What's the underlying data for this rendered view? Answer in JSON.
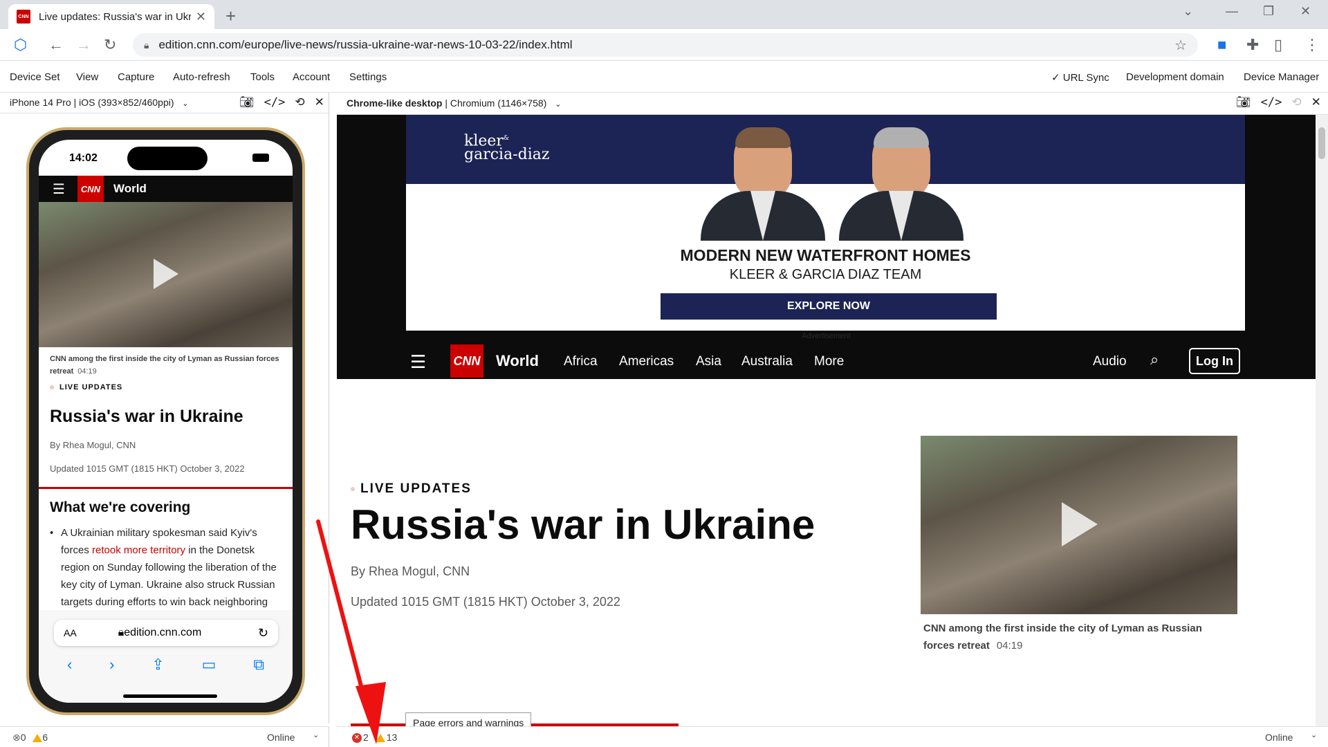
{
  "browser": {
    "tab_title": "Live updates: Russia's war in Ukraine",
    "favicon_text": "CNN",
    "url": "edition.cnn.com/europe/live-news/russia-ukraine-war-news-10-03-22/index.html"
  },
  "menubar": {
    "left": [
      "Device Set",
      "View",
      "Capture",
      "Auto-refresh",
      "Tools",
      "Account",
      "Settings"
    ],
    "url_sync": "✓ URL Sync",
    "dev_domain": "Development domain",
    "device_manager": "Device Manager"
  },
  "left_pane": {
    "device": "iPhone 14 Pro",
    "device_detail": " | iOS (393×852/460ppi)",
    "phone_time": "14:02",
    "nav_logo": "CNN",
    "nav_section": "World",
    "video_caption": "CNN among the first inside the city of Lyman as Russian forces retreat",
    "video_duration": "04:19",
    "live_label": "LIVE UPDATES",
    "title": "Russia's war in Ukraine",
    "byline": "By Rhea Mogul, CNN",
    "updated": "Updated 1015 GMT (1815 HKT) October 3, 2022",
    "covering_heading": "What we're covering",
    "bullet_pre": "A Ukrainian military spokesman said Kyiv's forces ",
    "bullet_link": "retook more territory",
    "bullet_post": " in the Donetsk region on Sunday following the liberation of the key city of Lyman. Ukraine also struck Russian targets during efforts to win back neighboring Luhansk, the spokesman added.",
    "safari_aa": "AA",
    "safari_host": "edition.cnn.com",
    "status_errors": "0",
    "status_warnings": "6",
    "status_online": "Online"
  },
  "right_pane": {
    "device": "Chrome-like desktop",
    "device_detail": " | Chromium (1146×758)",
    "ad": {
      "logo_line1": "kleer",
      "logo_amp": "&",
      "logo_line2": "garcia-diaz",
      "headline": "MODERN NEW WATERFRONT HOMES",
      "subline": "KLEER & GARCIA DIAZ TEAM",
      "cta": "EXPLORE NOW",
      "label": "Advertisement"
    },
    "nav": {
      "logo": "CNN",
      "world": "World",
      "links": [
        "Africa",
        "Americas",
        "Asia",
        "Australia",
        "More"
      ],
      "audio": "Audio",
      "login": "Log In"
    },
    "live_label": "LIVE UPDATES",
    "title": "Russia's war in Ukraine",
    "byline": "By Rhea Mogul, CNN",
    "updated": "Updated 1015 GMT (1815 HKT) October 3, 2022",
    "video_caption": "CNN among the first inside the city of Lyman as Russian forces retreat",
    "video_duration": "04:19",
    "tooltip": "Page errors and warnings",
    "status_errors": "2",
    "status_warnings": "13",
    "status_online": "Online"
  },
  "colors": {
    "cnn_red": "#cc0000",
    "ad_navy": "#1c2455",
    "arrow_red": "#ee1111"
  }
}
